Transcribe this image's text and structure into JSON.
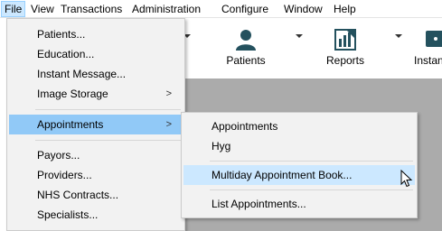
{
  "menubar": {
    "items": [
      {
        "label": "File"
      },
      {
        "label": "View"
      },
      {
        "label": "Transactions"
      },
      {
        "label": "Administration"
      },
      {
        "label": "Configure"
      },
      {
        "label": "Window"
      },
      {
        "label": "Help"
      }
    ]
  },
  "toolbar": {
    "patients_label": "Patients",
    "reports_label": "Reports",
    "instant_label": "Instant"
  },
  "file_menu": {
    "items": [
      {
        "label": "Patients..."
      },
      {
        "label": "Education..."
      },
      {
        "label": "Instant Message..."
      },
      {
        "label": "Image Storage"
      },
      {
        "label": "Appointments"
      },
      {
        "label": "Payors..."
      },
      {
        "label": "Providers..."
      },
      {
        "label": "NHS Contracts..."
      },
      {
        "label": "Specialists..."
      }
    ]
  },
  "appointments_submenu": {
    "items": [
      {
        "label": "Appointments"
      },
      {
        "label": "Hyg"
      },
      {
        "label": "Multiday Appointment Book..."
      },
      {
        "label": "List Appointments..."
      }
    ]
  },
  "colors": {
    "highlight": "#91c9f7",
    "menu_bg": "#f2f2f2",
    "toolbar_icon": "#24515e",
    "pane_gray": "#ababab"
  }
}
